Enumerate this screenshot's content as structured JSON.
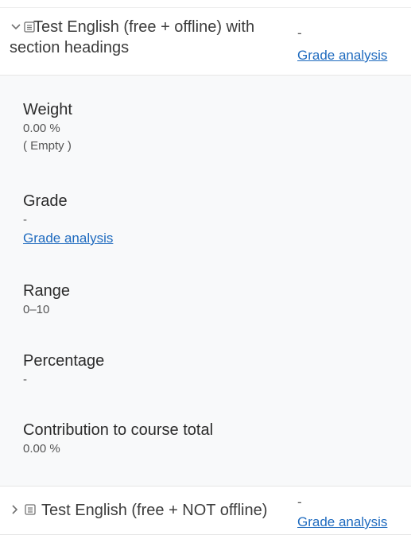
{
  "items": [
    {
      "title": "Test English (free + offline) with section headings",
      "grade": "-",
      "grade_link": "Grade analysis",
      "expanded": true
    },
    {
      "title": "Test English (free + NOT offline)",
      "grade": "-",
      "grade_link": "Grade analysis",
      "expanded": false
    }
  ],
  "details": {
    "weight": {
      "label": "Weight",
      "value": "0.00 %",
      "note": "( Empty )"
    },
    "grade": {
      "label": "Grade",
      "value": "-",
      "link": "Grade analysis"
    },
    "range": {
      "label": "Range",
      "value": "0–10"
    },
    "percentage": {
      "label": "Percentage",
      "value": "-"
    },
    "contribution": {
      "label": "Contribution to course total",
      "value": "0.00 %"
    }
  },
  "icons": {
    "expanded_chevron": "chevron-down-icon",
    "collapsed_chevron": "chevron-right-icon",
    "item_icon": "quiz-icon"
  },
  "colors": {
    "link": "#1f6bbf",
    "details_bg": "#f8f9fa"
  }
}
